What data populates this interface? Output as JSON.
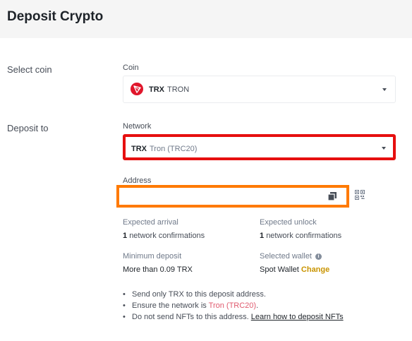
{
  "header": {
    "title": "Deposit Crypto"
  },
  "select_coin": {
    "row_label": "Select coin",
    "field_label": "Coin",
    "symbol": "TRX",
    "name": "TRON",
    "icon": "tron-logo-icon"
  },
  "deposit_to": {
    "row_label": "Deposit to",
    "network_label": "Network",
    "network_symbol": "TRX",
    "network_name": "Tron (TRC20)",
    "address_label": "Address",
    "address_value": ""
  },
  "details": {
    "expected_arrival_label": "Expected arrival",
    "expected_arrival_count": "1",
    "expected_arrival_text": "network confirmations",
    "expected_unlock_label": "Expected unlock",
    "expected_unlock_count": "1",
    "expected_unlock_text": "network confirmations",
    "minimum_deposit_label": "Minimum deposit",
    "minimum_deposit_value": "More than 0.09 TRX",
    "selected_wallet_label": "Selected wallet",
    "selected_wallet_value": "Spot Wallet",
    "change_link": "Change"
  },
  "notes": {
    "line1": "Send only TRX to this deposit address.",
    "line2_prefix": "Ensure the network is ",
    "line2_network": "Tron (TRC20)",
    "line2_suffix": ".",
    "line3_prefix": "Do not send NFTs to this address. ",
    "line3_link": "Learn how to deposit NFTs"
  },
  "colors": {
    "network_highlight": "#e60f0f",
    "address_highlight": "#ff7a00",
    "link_gold": "#c99400",
    "tron_red": "#e0162b"
  }
}
